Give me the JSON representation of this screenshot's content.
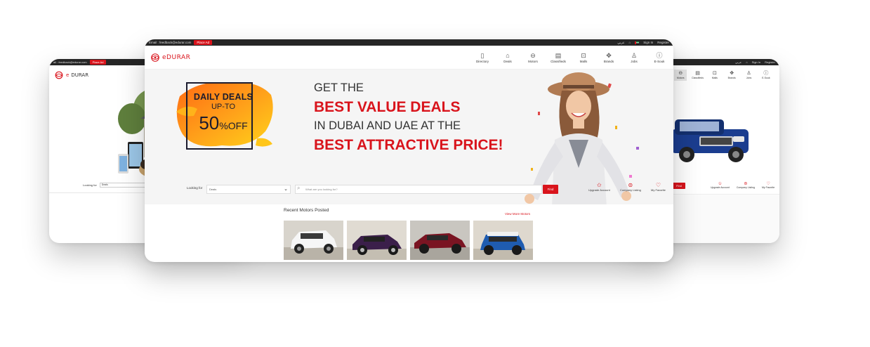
{
  "colors": {
    "brand_red": "#d9141c",
    "dark_bar": "#262626",
    "navy": "#1b1b2e"
  },
  "main": {
    "topbar": {
      "email": "Email : feedback@edurar.com",
      "place_ad": "Place Ad",
      "lang": "عربي",
      "sign_in": "Sign In",
      "register": "Register"
    },
    "logo": {
      "brand_e": "e",
      "brand_rest": "DURAR"
    },
    "nav": [
      {
        "label": "Directory",
        "icon": "directory-icon",
        "glyph": "▯"
      },
      {
        "label": "Deals",
        "icon": "deals-bag-icon",
        "glyph": "⌂"
      },
      {
        "label": "Motors",
        "icon": "car-icon",
        "glyph": "⊖"
      },
      {
        "label": "Classifieds",
        "icon": "classifieds-icon",
        "glyph": "▤"
      },
      {
        "label": "Malls",
        "icon": "cart-icon",
        "glyph": "⊡"
      },
      {
        "label": "Brands",
        "icon": "brands-icon",
        "glyph": "✥"
      },
      {
        "label": "Jobs",
        "icon": "jobs-icon",
        "glyph": "♙"
      },
      {
        "label": "E-Souk",
        "icon": "info-icon",
        "glyph": "ⓘ"
      }
    ],
    "promo": {
      "line1": "DAILY DEALS",
      "line2": "UP-TO",
      "num": "50",
      "pct": "%",
      "off": "OFF"
    },
    "headline": {
      "l1": "GET THE",
      "l2": "BEST VALUE DEALS",
      "l3": "IN DUBAI AND UAE AT THE",
      "l4": "BEST ATTRACTIVE PRICE!"
    },
    "search": {
      "looking_for": "Looking for",
      "category": "Deals",
      "placeholder": "What are you looking for?",
      "find": "Find"
    },
    "quick_links": [
      {
        "label": "Upgrade Account",
        "icon": "star-icon",
        "glyph": "✩"
      },
      {
        "label": "Company Listing",
        "icon": "listing-icon",
        "glyph": "⊜"
      },
      {
        "label": "My Favorite",
        "icon": "heart-icon",
        "glyph": "♡"
      }
    ],
    "recent": {
      "title": "Recent Motors Posted",
      "view_more": "View More Motors"
    }
  },
  "left": {
    "topbar": {
      "email": "ail : feedback@edurar.com",
      "place_ad": "Place Ad"
    },
    "looking_for": "Looking for",
    "category": "Deals"
  },
  "right": {
    "topbar": {
      "lang": "عربي",
      "sign_in": "Sign In",
      "register": "Register"
    },
    "nav": [
      {
        "label": "Motors",
        "glyph": "⊖"
      },
      {
        "label": "Classifieds",
        "glyph": "▤"
      },
      {
        "label": "Malls",
        "glyph": "⊡"
      },
      {
        "label": "Brands",
        "glyph": "✥"
      },
      {
        "label": "Jobs",
        "glyph": "♙"
      },
      {
        "label": "E-Souk",
        "glyph": "ⓘ"
      }
    ],
    "find": "Find",
    "quick_links": [
      {
        "label": "Upgrade Account",
        "glyph": "✩"
      },
      {
        "label": "Company Listing",
        "glyph": "⊜"
      },
      {
        "label": "My Favorite",
        "glyph": "♡"
      }
    ]
  }
}
